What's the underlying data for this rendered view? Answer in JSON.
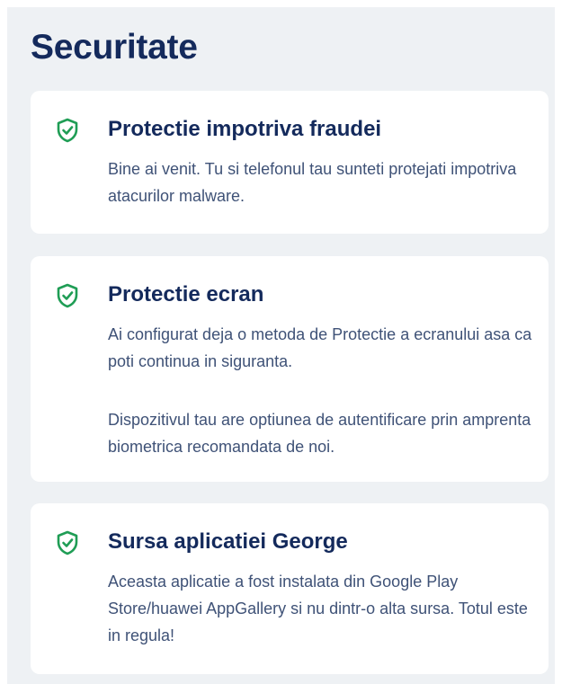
{
  "page": {
    "title": "Securitate"
  },
  "cards": [
    {
      "title": "Protectie impotriva fraudei",
      "paragraphs": [
        "Bine ai venit. Tu si telefonul tau sunteti protejati impotriva atacurilor malware."
      ],
      "icon": "shield-check-icon"
    },
    {
      "title": "Protectie ecran",
      "paragraphs": [
        "Ai configurat deja o metoda de Protectie a ecranului asa ca poti continua in siguranta.",
        "Dispozitivul tau are optiunea de autentificare prin amprenta biometrica recomandata de noi."
      ],
      "icon": "shield-check-icon"
    },
    {
      "title": "Sursa aplicatiei George",
      "paragraphs": [
        "Aceasta aplicatie a fost instalata din Google Play Store/huawei AppGallery si nu dintr-o alta sursa. Totul este in regula!"
      ],
      "icon": "shield-check-icon"
    }
  ],
  "colors": {
    "background": "#eef1f4",
    "card": "#ffffff",
    "title": "#142a5c",
    "body_text": "#3f5277",
    "check_green": "#1f9d55"
  }
}
